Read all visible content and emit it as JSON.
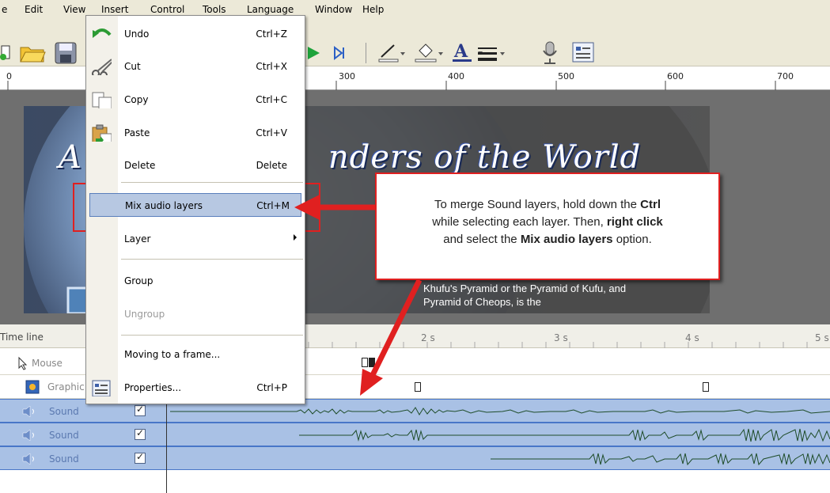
{
  "menubar": {
    "items": [
      {
        "label": "e"
      },
      {
        "label": "Edit"
      },
      {
        "label": "View"
      },
      {
        "label": "Insert"
      },
      {
        "label": "Control"
      },
      {
        "label": "Tools"
      },
      {
        "label": "Language"
      },
      {
        "label": "Window"
      },
      {
        "label": "Help"
      }
    ]
  },
  "ruler": {
    "labels": [
      "0",
      "300",
      "400",
      "500",
      "600",
      "700"
    ]
  },
  "slide": {
    "title_left": "A",
    "title_right": "nders of the World",
    "body": "Khufu's Pyramid or the Pyramid of Kufu, and Pyramid of Cheops, is the"
  },
  "callout": {
    "line1_pre": "To merge Sound layers, hold down the ",
    "line1_bold": "Ctrl",
    "line2_pre": "while selecting each layer. Then, ",
    "line2_bold": "right click",
    "line3_pre": "and select the ",
    "line3_bold": "Mix audio layers",
    "line3_post": " option."
  },
  "timeline": {
    "header_label": "Time line",
    "times": [
      "2 s",
      "3 s",
      "4 s",
      "5 s"
    ],
    "rows": [
      {
        "name": "Mouse"
      },
      {
        "name": "Graphic"
      }
    ],
    "sound_rows": [
      {
        "name": "Sound",
        "checked": true
      },
      {
        "name": "Sound",
        "checked": true
      },
      {
        "name": "Sound",
        "checked": true
      }
    ]
  },
  "context_menu": {
    "items": [
      {
        "label": "Undo",
        "shortcut": "Ctrl+Z",
        "icon": "undo-icon"
      },
      {
        "label": "Cut",
        "shortcut": "Ctrl+X",
        "icon": "cut-icon"
      },
      {
        "label": "Copy",
        "shortcut": "Ctrl+C",
        "icon": "copy-icon"
      },
      {
        "label": "Paste",
        "shortcut": "Ctrl+V",
        "icon": "paste-icon"
      },
      {
        "label": "Delete",
        "shortcut": "Delete"
      },
      {
        "label": "Mix audio layers",
        "shortcut": "Ctrl+M"
      },
      {
        "label": "Layer",
        "shortcut": ""
      },
      {
        "label": "Group",
        "shortcut": ""
      },
      {
        "label": "Ungroup",
        "shortcut": ""
      },
      {
        "label": "Moving to a frame...",
        "shortcut": ""
      },
      {
        "label": "Properties...",
        "shortcut": "Ctrl+P",
        "icon": "properties-icon"
      }
    ]
  },
  "colors": {
    "highlight_red": "#e02020",
    "menu_selected": "#b7c8e2",
    "sound_row": "#a9c1e5",
    "waveform": "#1f4d2a"
  }
}
